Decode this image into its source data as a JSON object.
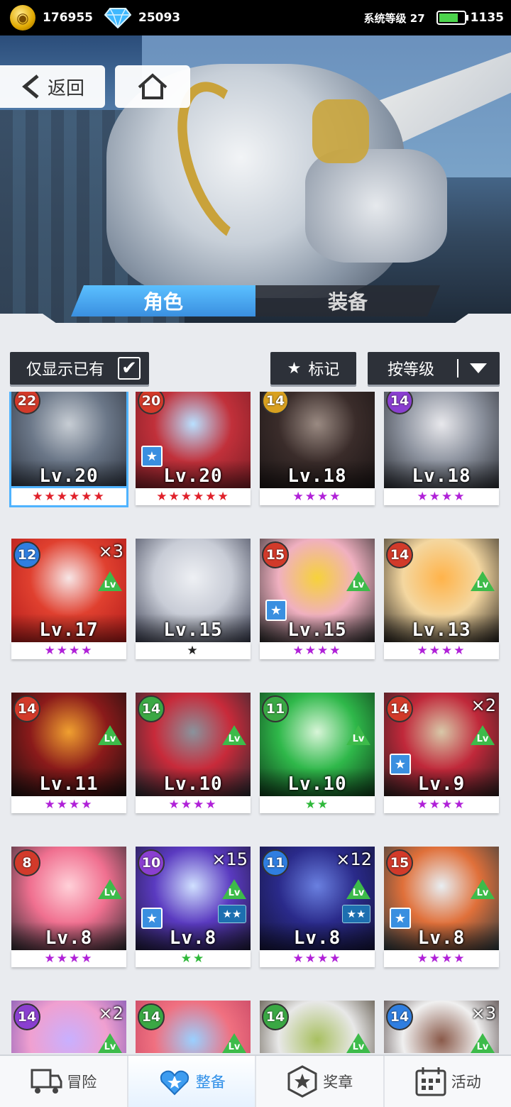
{
  "status": {
    "coins": "176955",
    "gems": "25093",
    "system_level_label": "系统等级",
    "system_level": "27",
    "stamina": "1135"
  },
  "nav": {
    "back_label": "返回",
    "home_icon": "home-icon"
  },
  "tabs": [
    {
      "label": "角色",
      "active": true
    },
    {
      "label": "装备",
      "active": false
    }
  ],
  "filters": {
    "owned_only_label": "仅显示已有",
    "owned_only_checked": true,
    "mark_label": "标记",
    "sort_label": "按等级"
  },
  "cards": [
    {
      "rank": "22",
      "level": "Lv.20",
      "stars": "★★★★★★",
      "star_color": "#e0202a",
      "rank_color": "#d23a2a",
      "selected": true,
      "marked": false,
      "count": "",
      "lvup": false,
      "evo": false,
      "art": [
        "#c7cdd4",
        "#6b7788",
        "#2d3440"
      ]
    },
    {
      "rank": "20",
      "level": "Lv.20",
      "stars": "★★★★★★",
      "star_color": "#e0202a",
      "rank_color": "#d23a2a",
      "selected": false,
      "marked": true,
      "count": "",
      "lvup": false,
      "evo": false,
      "art": [
        "#b9e0ff",
        "#c1303a",
        "#7a1d25"
      ]
    },
    {
      "rank": "14",
      "level": "Lv.18",
      "stars": "★★★★",
      "star_color": "#b020d8",
      "rank_color": "#d8a020",
      "selected": false,
      "marked": false,
      "count": "",
      "lvup": false,
      "evo": false,
      "art": [
        "#9a8a82",
        "#3a2c2a",
        "#1a1414"
      ]
    },
    {
      "rank": "14",
      "level": "Lv.18",
      "stars": "★★★★",
      "star_color": "#b020d8",
      "rank_color": "#8a3fd0",
      "selected": false,
      "marked": false,
      "count": "",
      "lvup": false,
      "evo": false,
      "art": [
        "#e8e8ec",
        "#8e94a0",
        "#2a2d34"
      ]
    },
    {
      "rank": "12",
      "level": "Lv.17",
      "stars": "★★★★",
      "star_color": "#b020d8",
      "rank_color": "#2f7ee0",
      "selected": false,
      "marked": false,
      "count": "×3",
      "lvup": true,
      "evo": false,
      "art": [
        "#f7e6e6",
        "#e0402f",
        "#b01a1a"
      ]
    },
    {
      "rank": "",
      "level": "Lv.15",
      "stars": "★",
      "star_color": "#222222",
      "rank_color": "",
      "selected": false,
      "marked": false,
      "count": "",
      "lvup": false,
      "evo": false,
      "art": [
        "#eef0f4",
        "#c8ccd6",
        "#3b3f52"
      ]
    },
    {
      "rank": "15",
      "level": "Lv.15",
      "stars": "★★★★",
      "star_color": "#b020d8",
      "rank_color": "#d23a2a",
      "selected": false,
      "marked": true,
      "count": "",
      "lvup": true,
      "evo": false,
      "art": [
        "#f6d23a",
        "#f0b0c0",
        "#2a2a2a"
      ]
    },
    {
      "rank": "14",
      "level": "Lv.13",
      "stars": "★★★★",
      "star_color": "#b020d8",
      "rank_color": "#d23a2a",
      "selected": false,
      "marked": false,
      "count": "",
      "lvup": true,
      "evo": false,
      "art": [
        "#ffb34a",
        "#f4d7a0",
        "#24201c"
      ]
    },
    {
      "rank": "14",
      "level": "Lv.11",
      "stars": "★★★★",
      "star_color": "#b020d8",
      "rank_color": "#d23a2a",
      "selected": false,
      "marked": false,
      "count": "",
      "lvup": true,
      "evo": false,
      "art": [
        "#f0a030",
        "#8a1a1a",
        "#1a1010"
      ]
    },
    {
      "rank": "14",
      "level": "Lv.10",
      "stars": "★★★★",
      "star_color": "#b020d8",
      "rank_color": "#3aa844",
      "selected": false,
      "marked": false,
      "count": "",
      "lvup": true,
      "evo": false,
      "art": [
        "#8a939c",
        "#c82a3a",
        "#252930"
      ]
    },
    {
      "rank": "11",
      "level": "Lv.10",
      "stars": "★★",
      "star_color": "#2fb83a",
      "rank_color": "#3aa844",
      "selected": false,
      "marked": false,
      "count": "",
      "lvup": true,
      "evo": false,
      "art": [
        "#d8f5d8",
        "#2fb84a",
        "#0e3a1a"
      ]
    },
    {
      "rank": "14",
      "level": "Lv.9",
      "stars": "★★★★",
      "star_color": "#b020d8",
      "rank_color": "#d23a2a",
      "selected": false,
      "marked": true,
      "count": "×2",
      "lvup": true,
      "evo": false,
      "art": [
        "#d8c8a8",
        "#c0283a",
        "#2a1e1e"
      ]
    },
    {
      "rank": "8",
      "level": "Lv.8",
      "stars": "★★★★",
      "star_color": "#b020d8",
      "rank_color": "#d23a2a",
      "selected": false,
      "marked": false,
      "count": "",
      "lvup": true,
      "evo": false,
      "art": [
        "#ffd0d8",
        "#f07090",
        "#2c2a30"
      ]
    },
    {
      "rank": "10",
      "level": "Lv.8",
      "stars": "★★",
      "star_color": "#2fb83a",
      "rank_color": "#8a3fd0",
      "selected": false,
      "marked": true,
      "count": "×15",
      "lvup": true,
      "evo": true,
      "art": [
        "#d0e0ff",
        "#5a3ac0",
        "#1e1a3a"
      ]
    },
    {
      "rank": "11",
      "level": "Lv.8",
      "stars": "★★★★",
      "star_color": "#b020d8",
      "rank_color": "#2f7ee0",
      "selected": false,
      "marked": false,
      "count": "×12",
      "lvup": true,
      "evo": true,
      "art": [
        "#6a80e0",
        "#2a2a8a",
        "#14143a"
      ]
    },
    {
      "rank": "15",
      "level": "Lv.8",
      "stars": "★★★★",
      "star_color": "#b020d8",
      "rank_color": "#d23a2a",
      "selected": false,
      "marked": true,
      "count": "",
      "lvup": true,
      "evo": false,
      "art": [
        "#e8eef2",
        "#e0703a",
        "#2a3a40"
      ]
    },
    {
      "rank": "14",
      "level": "",
      "stars": "",
      "star_color": "#b020d8",
      "rank_color": "#8a3fd0",
      "selected": false,
      "marked": false,
      "count": "×2",
      "lvup": true,
      "evo": false,
      "art": [
        "#c8b0ff",
        "#f0a0d0",
        "#6a4ab0"
      ]
    },
    {
      "rank": "14",
      "level": "",
      "stars": "",
      "star_color": "#b020d8",
      "rank_color": "#3aa844",
      "selected": false,
      "marked": false,
      "count": "",
      "lvup": true,
      "evo": false,
      "art": [
        "#9ad0ff",
        "#f07080",
        "#c04060"
      ]
    },
    {
      "rank": "14",
      "level": "",
      "stars": "",
      "star_color": "#b020d8",
      "rank_color": "#3aa844",
      "selected": false,
      "marked": false,
      "count": "",
      "lvup": true,
      "evo": false,
      "art": [
        "#a8c060",
        "#e8e8e8",
        "#3a3020"
      ]
    },
    {
      "rank": "14",
      "level": "",
      "stars": "",
      "star_color": "#b020d8",
      "rank_color": "#2f7ee0",
      "selected": false,
      "marked": false,
      "count": "×3",
      "lvup": true,
      "evo": false,
      "art": [
        "#8a5a4a",
        "#f0f0f0",
        "#2a1a1a"
      ]
    }
  ],
  "lvup_label": "Lv",
  "evo_label": "★★",
  "bottom_nav": [
    {
      "label": "冒险",
      "icon": "truck-icon",
      "active": false
    },
    {
      "label": "整备",
      "icon": "heart-crest-icon",
      "active": true
    },
    {
      "label": "奖章",
      "icon": "medal-star-icon",
      "active": false
    },
    {
      "label": "活动",
      "icon": "calendar-icon",
      "active": false
    }
  ]
}
